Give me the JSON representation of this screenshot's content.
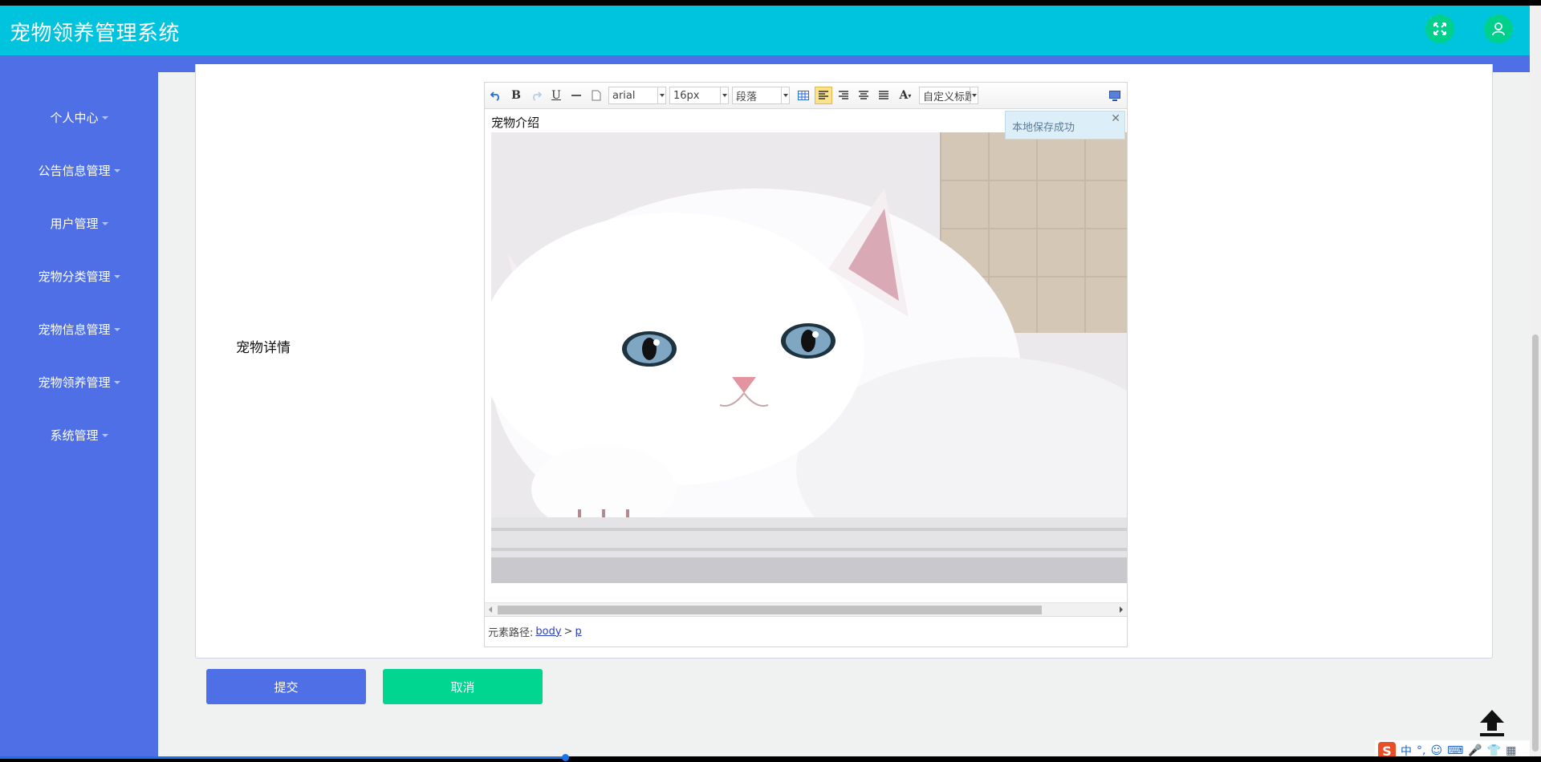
{
  "app": {
    "title": "宠物领养管理系统"
  },
  "header": {
    "fullscreen_icon": "expand-icon",
    "user_icon": "user-icon"
  },
  "sidebar": {
    "items": [
      {
        "label": "个人中心"
      },
      {
        "label": "公告信息管理"
      },
      {
        "label": "用户管理"
      },
      {
        "label": "宠物分类管理"
      },
      {
        "label": "宠物信息管理"
      },
      {
        "label": "宠物领养管理"
      },
      {
        "label": "系统管理"
      }
    ]
  },
  "form": {
    "field_label": "宠物详情",
    "submit_label": "提交",
    "cancel_label": "取消"
  },
  "editor": {
    "toolbar": {
      "font_family": "arial",
      "font_size": "16px",
      "paragraph": "段落",
      "custom_title": "自定义标题"
    },
    "content_text": "宠物介绍",
    "notice": "本地保存成功",
    "status_prefix": "元素路径:",
    "path_body": "body",
    "path_sep": ">",
    "path_p": "p"
  },
  "ime": {
    "logo": "S",
    "mode": "中"
  }
}
